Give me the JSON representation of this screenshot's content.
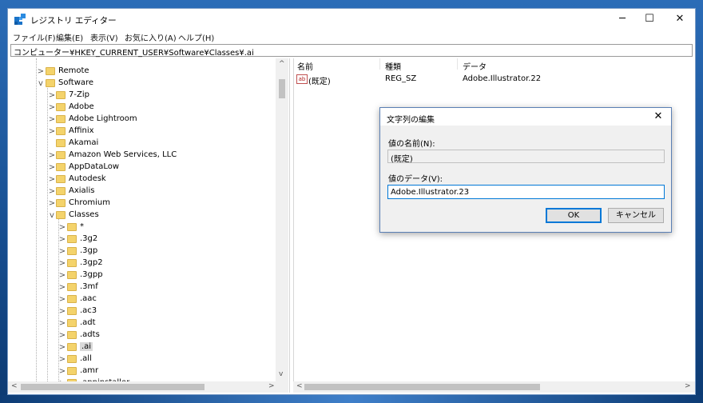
{
  "window": {
    "title": "レジストリ エディター",
    "minimize": "─",
    "maximize": "☐",
    "close": "✕"
  },
  "menu": [
    "ファイル(F)",
    "編集(E)",
    "表示(V)",
    "お気に入り(A)",
    "ヘルプ(H)"
  ],
  "address": "コンピューター¥HKEY_CURRENT_USER¥Software¥Classes¥.ai",
  "tree": [
    {
      "label": "Remote",
      "level": 0,
      "expander": ">"
    },
    {
      "label": "Software",
      "level": 0,
      "expander": "v"
    },
    {
      "label": "7-Zip",
      "level": 1,
      "expander": ">"
    },
    {
      "label": "Adobe",
      "level": 1,
      "expander": ">"
    },
    {
      "label": "Adobe Lightroom",
      "level": 1,
      "expander": ">"
    },
    {
      "label": "Affinix",
      "level": 1,
      "expander": ">"
    },
    {
      "label": "Akamai",
      "level": 1,
      "expander": ""
    },
    {
      "label": "Amazon Web Services, LLC",
      "level": 1,
      "expander": ">"
    },
    {
      "label": "AppDataLow",
      "level": 1,
      "expander": ">"
    },
    {
      "label": "Autodesk",
      "level": 1,
      "expander": ">"
    },
    {
      "label": "Axialis",
      "level": 1,
      "expander": ">"
    },
    {
      "label": "Chromium",
      "level": 1,
      "expander": ">"
    },
    {
      "label": "Classes",
      "level": 1,
      "expander": "v"
    },
    {
      "label": "*",
      "level": 2,
      "expander": ">"
    },
    {
      "label": ".3g2",
      "level": 2,
      "expander": ">"
    },
    {
      "label": ".3gp",
      "level": 2,
      "expander": ">"
    },
    {
      "label": ".3gp2",
      "level": 2,
      "expander": ">"
    },
    {
      "label": ".3gpp",
      "level": 2,
      "expander": ">"
    },
    {
      "label": ".3mf",
      "level": 2,
      "expander": ">"
    },
    {
      "label": ".aac",
      "level": 2,
      "expander": ">"
    },
    {
      "label": ".ac3",
      "level": 2,
      "expander": ">"
    },
    {
      "label": ".adt",
      "level": 2,
      "expander": ">"
    },
    {
      "label": ".adts",
      "level": 2,
      "expander": ">"
    },
    {
      "label": ".ai",
      "level": 2,
      "expander": ">",
      "selected": true
    },
    {
      "label": ".all",
      "level": 2,
      "expander": ">"
    },
    {
      "label": ".amr",
      "level": 2,
      "expander": ">"
    },
    {
      "label": ".appinstaller",
      "level": 2,
      "expander": ">"
    }
  ],
  "list": {
    "columns": [
      "名前",
      "種類",
      "データ"
    ],
    "rows": [
      {
        "name": "(既定)",
        "type": "REG_SZ",
        "data": "Adobe.Illustrator.22",
        "icon_text": "ab"
      }
    ]
  },
  "dialog": {
    "title": "文字列の編集",
    "close": "✕",
    "name_label": "値の名前(N):",
    "name_value": "(既定)",
    "data_label": "値のデータ(V):",
    "data_value": "Adobe.Illustrator.23",
    "ok": "OK",
    "cancel": "キャンセル"
  },
  "scroll_arrows": {
    "up": "^",
    "down": "v",
    "left": "<",
    "right": ">"
  }
}
